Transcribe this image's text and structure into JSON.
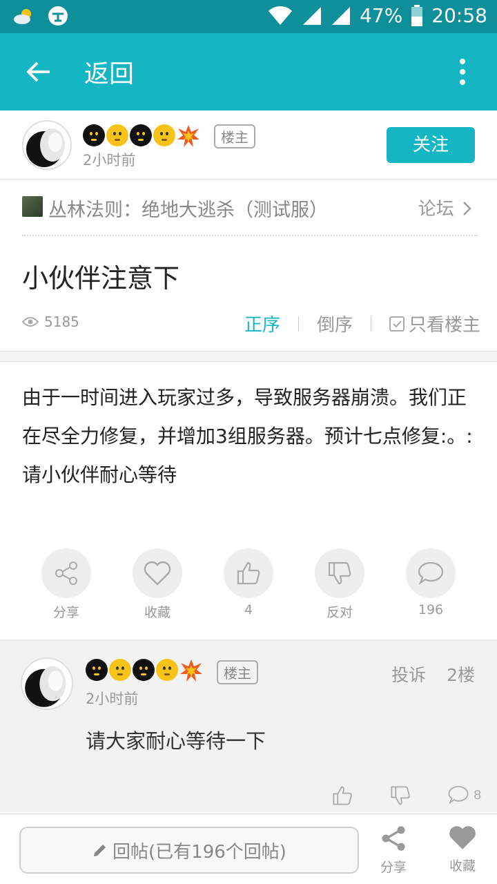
{
  "status_bar": {
    "battery": "47%",
    "time": "20:58",
    "icons": [
      "weather-icon",
      "chat-app-icon",
      "wifi-icon",
      "signal-icon",
      "signal-icon",
      "battery-icon"
    ]
  },
  "app_bar": {
    "back_label": "返回",
    "icons": [
      "back-arrow-icon",
      "more-vert-icon"
    ]
  },
  "author": {
    "tag": "楼主",
    "time": "2小时前",
    "follow_label": "关注"
  },
  "forum": {
    "name": "丛林法则：绝地大逃杀（测试服）",
    "link_label": "论坛"
  },
  "post": {
    "title": "小伙伴注意下",
    "views": "5185",
    "sort_options": [
      "正序",
      "倒序"
    ],
    "owner_only": "只看楼主",
    "content": "由于一时间进入玩家过多，导致服务器崩溃。我们正在尽全力修复，并增加3组服务器。预计七点修复:。:请小伙伴耐心等待"
  },
  "actions": {
    "share": "分享",
    "favorite": "收藏",
    "like_count": "4",
    "oppose": "反对",
    "comment_count": "196"
  },
  "reply": {
    "tag": "楼主",
    "time": "2小时前",
    "report": "投诉",
    "floor": "2楼",
    "text": "请大家耐心等待一下",
    "comment_count": "8"
  },
  "bottom_bar": {
    "reply_placeholder": "回帖(已有196个回帖)",
    "share": "分享",
    "favorite": "收藏"
  },
  "colors": {
    "accent": "#14b6c4",
    "status_bar": "#0e8f99"
  }
}
